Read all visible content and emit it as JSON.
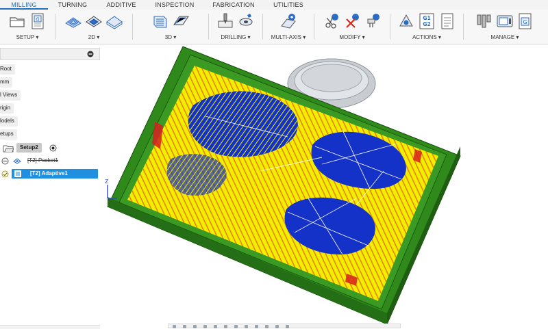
{
  "tabs": [
    {
      "label": "MILLING",
      "active": true
    },
    {
      "label": "TURNING",
      "active": false
    },
    {
      "label": "ADDITIVE",
      "active": false
    },
    {
      "label": "INSPECTION",
      "active": false
    },
    {
      "label": "FABRICATION",
      "active": false
    },
    {
      "label": "UTILITIES",
      "active": false
    }
  ],
  "toolbar": {
    "setup": "SETUP ▾",
    "two_d": "2D ▾",
    "three_d": "3D ▾",
    "drilling": "DRILLING ▾",
    "multi_axis": "MULTI-AXIS ▾",
    "modify": "MODIFY ▾",
    "actions": "ACTIONS ▾",
    "manage": "MANAGE ▾",
    "g1g2_line1": "G1",
    "g1g2_line2": "G2",
    "g_badge": "G"
  },
  "browser": {
    "nodes": [
      "Root",
      "mm",
      "l Views",
      "rigin",
      "lodels",
      "etups"
    ],
    "setup_label": "Setup2",
    "ops": [
      {
        "label": "[T2] Pocket1",
        "suppressed": true,
        "selected": false
      },
      {
        "label": "[T2] Adaptive1",
        "suppressed": false,
        "selected": true
      }
    ]
  },
  "viewport": {
    "axis_label": "Z",
    "colors": {
      "stock": "#2f8a1b",
      "toolpath": "#f2ee00",
      "floor": "#1432c8",
      "rapid": "#d81e1e",
      "fixture": "#c9cdd2"
    }
  },
  "icons": {
    "setup_folder": "folder-setup-icon",
    "new_setup": "new-setup-icon",
    "two_d_ops": [
      "2d-adaptive-icon",
      "2d-pocket-icon",
      "face-icon"
    ],
    "three_d_ops": [
      "3d-adaptive-icon",
      "3d-pocket-icon"
    ],
    "drilling": "drill-icon",
    "multi_axis": "multi-axis-icon",
    "modify": [
      "cut-icon",
      "delete-icon",
      "tool-icon"
    ],
    "actions": [
      "simulate-icon",
      "post-process-icon",
      "setup-sheet-icon"
    ],
    "manage": [
      "tool-library-icon",
      "machine-library-icon",
      "template-icon"
    ]
  }
}
